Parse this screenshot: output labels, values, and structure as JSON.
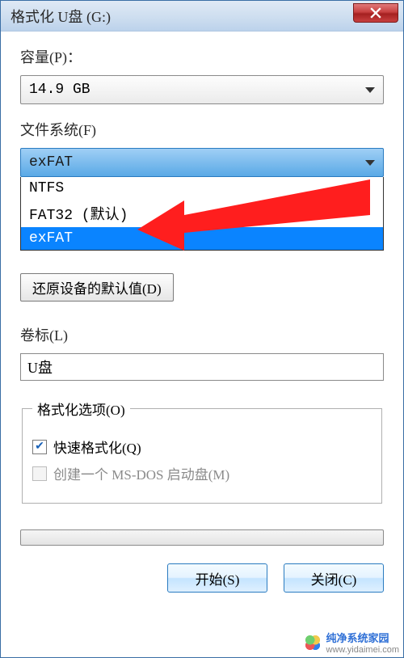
{
  "window": {
    "title": "格式化 U盘 (G:)"
  },
  "capacity": {
    "label": "容量(P)：",
    "value": "14.9 GB"
  },
  "filesystem": {
    "label": "文件系统(F)",
    "value": "exFAT",
    "options": [
      "NTFS",
      "FAT32 (默认)",
      "exFAT"
    ],
    "selectedIndex": 2
  },
  "restore_defaults_label": "还原设备的默认值(D)",
  "volume": {
    "label": "卷标(L)",
    "value": "U盘"
  },
  "format_options": {
    "legend": "格式化选项(O)",
    "quick_format": {
      "label": "快速格式化(Q)",
      "checked": true
    },
    "msdos_boot": {
      "label": "创建一个 MS-DOS 启动盘(M)",
      "checked": false,
      "disabled": true
    }
  },
  "buttons": {
    "start": "开始(S)",
    "close": "关闭(C)"
  },
  "watermark": {
    "text": "纯净系统家园",
    "url": "www.yidaimei.com"
  }
}
